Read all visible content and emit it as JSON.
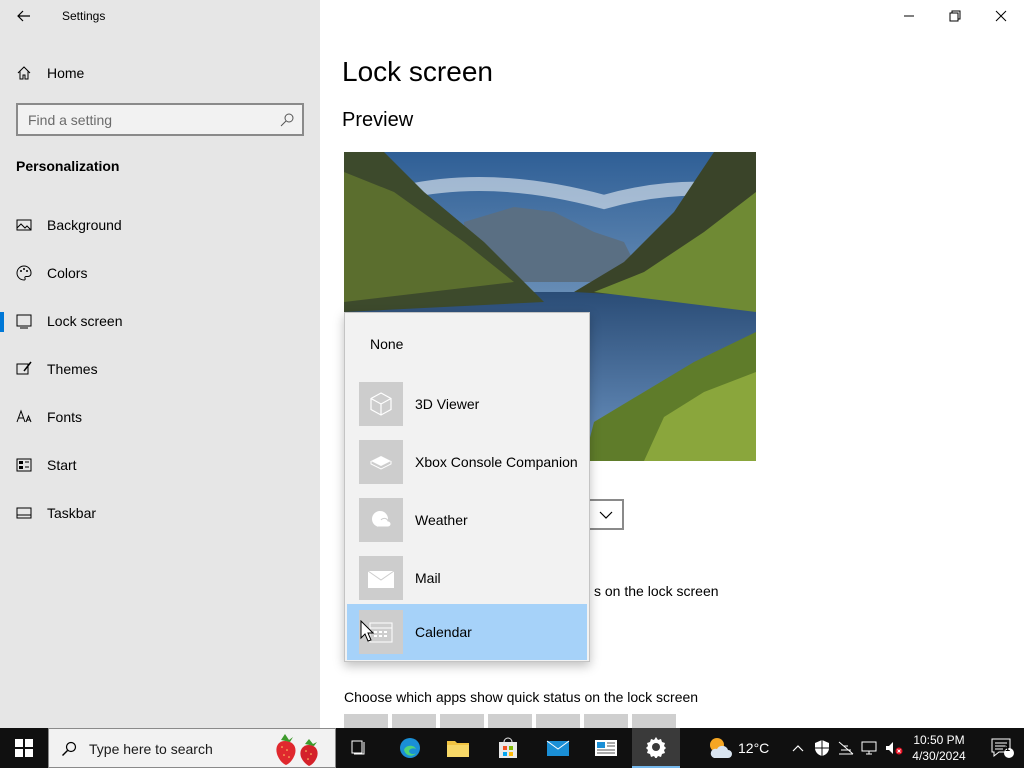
{
  "window": {
    "title": "Settings"
  },
  "sidebar": {
    "home_label": "Home",
    "search_placeholder": "Find a setting",
    "section_title": "Personalization",
    "items": [
      {
        "label": "Background",
        "icon": "picture-icon",
        "active": false
      },
      {
        "label": "Colors",
        "icon": "palette-icon",
        "active": false
      },
      {
        "label": "Lock screen",
        "icon": "lock-screen-icon",
        "active": true
      },
      {
        "label": "Themes",
        "icon": "brush-icon",
        "active": false
      },
      {
        "label": "Fonts",
        "icon": "font-icon",
        "active": false
      },
      {
        "label": "Start",
        "icon": "start-icon",
        "active": false
      },
      {
        "label": "Taskbar",
        "icon": "taskbar-icon",
        "active": false
      }
    ]
  },
  "main": {
    "page_title": "Lock screen",
    "preview_title": "Preview",
    "lockscreen_text": "s on the lock screen",
    "quick_status_title": "Choose which apps show quick status on the lock screen"
  },
  "dropdown": {
    "none_label": "None",
    "items": [
      {
        "label": "3D Viewer",
        "icon": "cube-icon",
        "selected": false
      },
      {
        "label": "Xbox Console Companion",
        "icon": "console-icon",
        "selected": false
      },
      {
        "label": "Weather",
        "icon": "weather-icon",
        "selected": false
      },
      {
        "label": "Mail",
        "icon": "mail-icon",
        "selected": false
      },
      {
        "label": "Calendar",
        "icon": "calendar-icon",
        "selected": true
      }
    ]
  },
  "taskbar": {
    "search_placeholder": "Type here to search",
    "weather_temp": "12°C",
    "time": "10:50 PM",
    "date": "4/30/2024",
    "notification_count": "1"
  },
  "colors": {
    "accent": "#0078d7",
    "selected_item": "#a6d2f9",
    "sidebar_bg": "#e6e6e6",
    "taskbar_bg": "#101010"
  }
}
